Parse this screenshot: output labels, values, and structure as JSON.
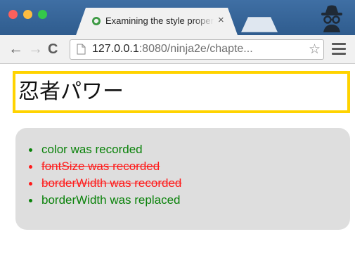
{
  "browser": {
    "tab": {
      "title": "Examining the style properties",
      "close_glyph": "×",
      "favicon": "qunit-favicon"
    },
    "toolbar": {
      "back_glyph": "←",
      "forward_glyph": "→",
      "reload_glyph": "C",
      "url_host": "127.0.0.1",
      "url_rest": ":8080/ninja2e/chapte...",
      "bookmark_glyph": "☆"
    },
    "icons": [
      "back-arrow-icon",
      "forward-arrow-icon",
      "reload-icon",
      "page-icon",
      "star-icon",
      "hamburger-menu-icon",
      "incognito-icon"
    ]
  },
  "page": {
    "heading": "忍者パワー",
    "heading_border_color": "#ffd300",
    "log": [
      {
        "text": "color was recorded",
        "status": "pass"
      },
      {
        "text": "fontSize was recorded",
        "status": "fail"
      },
      {
        "text": "borderWidth was recorded",
        "status": "fail"
      },
      {
        "text": "borderWidth was replaced",
        "status": "pass"
      }
    ],
    "colors": {
      "pass": "#0a820a",
      "fail": "#ff1a1a",
      "log_background": "#dedede"
    }
  }
}
